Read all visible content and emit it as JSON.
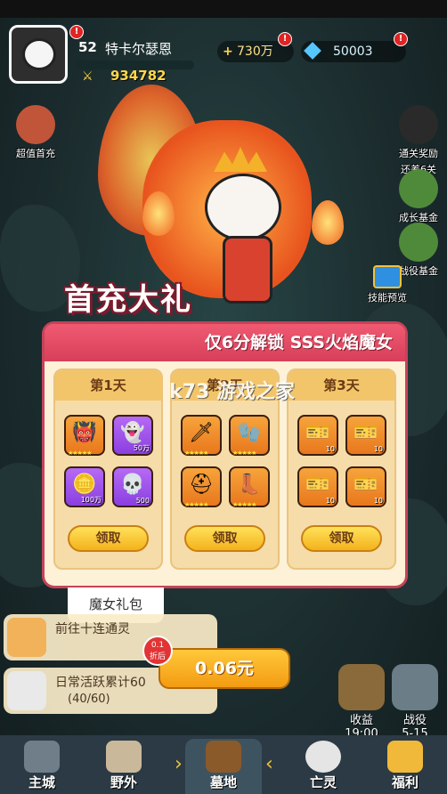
{
  "player": {
    "level": "52",
    "name": "特卡尔瑟恩",
    "power": "934782"
  },
  "currency": {
    "gold": "730万",
    "gems": "50003"
  },
  "side_left": [
    {
      "label": "超值首充"
    }
  ],
  "side_right": [
    {
      "label": "通关奖励",
      "sub": "还差6关"
    },
    {
      "label": "成长基金"
    },
    {
      "label": "战役基金"
    }
  ],
  "skill_preview": "技能预览",
  "title": "首充大礼",
  "subtitle": "仅6分解锁 SSS火焰魔女",
  "days": [
    {
      "label": "第1天",
      "items": [
        {
          "qty": ""
        },
        {
          "qty": "50万"
        },
        {
          "qty": "100万"
        },
        {
          "qty": "500"
        }
      ],
      "claim": "领取"
    },
    {
      "label": "第2天",
      "items": [
        {
          "qty": ""
        },
        {
          "qty": ""
        },
        {
          "qty": ""
        },
        {
          "qty": ""
        }
      ],
      "claim": "领取"
    },
    {
      "label": "第3天",
      "items": [
        {
          "qty": "10"
        },
        {
          "qty": "10"
        },
        {
          "qty": "10"
        },
        {
          "qty": "10"
        }
      ],
      "claim": "领取"
    }
  ],
  "gift_tab": "魔女礼包",
  "discount": {
    "line1": "0.1",
    "line2": "折后"
  },
  "price": "0.06元",
  "tasks": [
    {
      "text": "前往十连通灵",
      "sub": ""
    },
    {
      "text": "日常活跃累计60",
      "sub": "(40/60)"
    }
  ],
  "right_buttons": [
    {
      "label": "收益",
      "sub": "19:00"
    },
    {
      "label": "战役",
      "sub": "5-15"
    }
  ],
  "nav": [
    {
      "label": "主城"
    },
    {
      "label": "野外"
    },
    {
      "label": "墓地"
    },
    {
      "label": "亡灵"
    },
    {
      "label": "福利"
    }
  ],
  "watermark": "k73 游戏之家",
  "colors": {
    "accent": "#d83f5a",
    "gold": "#f4b21c"
  }
}
